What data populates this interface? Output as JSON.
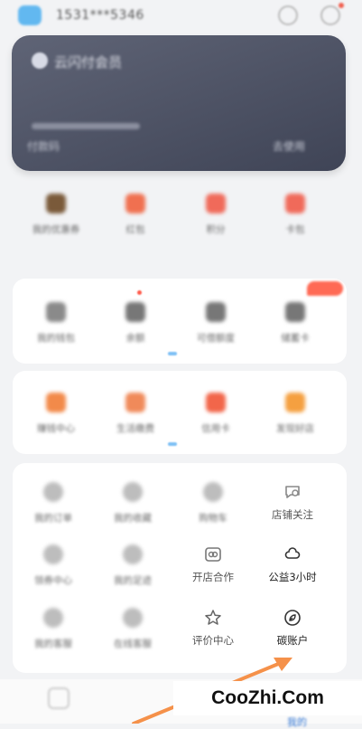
{
  "header": {
    "phone": "1531***5346"
  },
  "card": {
    "title": "云闪付会员",
    "footer_left": "付款码",
    "footer_right": "去使用"
  },
  "row1": [
    {
      "label": "我的优惠券",
      "color": "#7a5a3a"
    },
    {
      "label": "红包",
      "color": "#f07050"
    },
    {
      "label": "积分",
      "color": "#f06a5a"
    },
    {
      "label": "卡包",
      "color": "#f06a5a"
    }
  ],
  "row2": [
    {
      "label": "我的钱包",
      "color": "#8a8a8a"
    },
    {
      "label": "余额",
      "color": "#777"
    },
    {
      "label": "可借额度",
      "color": "#777"
    },
    {
      "label": "储蓄卡",
      "color": "#777"
    }
  ],
  "row3": [
    {
      "label": "赚钱中心",
      "color": "#f28a4a"
    },
    {
      "label": "生活缴费",
      "color": "#f08a5a"
    },
    {
      "label": "信用卡",
      "color": "#f2664a"
    },
    {
      "label": "发现好店",
      "color": "#f5a040"
    }
  ],
  "services": {
    "row1": [
      "我的订单",
      "我的收藏",
      "购物车",
      "店铺关注"
    ],
    "row2": [
      "领券中心",
      "我的足迹",
      "开店合作",
      "公益3小时"
    ],
    "row3": [
      "我的客服",
      "在线客服",
      "评价中心",
      "碳账户"
    ]
  },
  "bottom_nav": {
    "mine": "我的"
  },
  "watermark": "CooZhi.Com",
  "colors": {
    "arrow": "#f5914a",
    "accent": "#3a7bd5"
  }
}
